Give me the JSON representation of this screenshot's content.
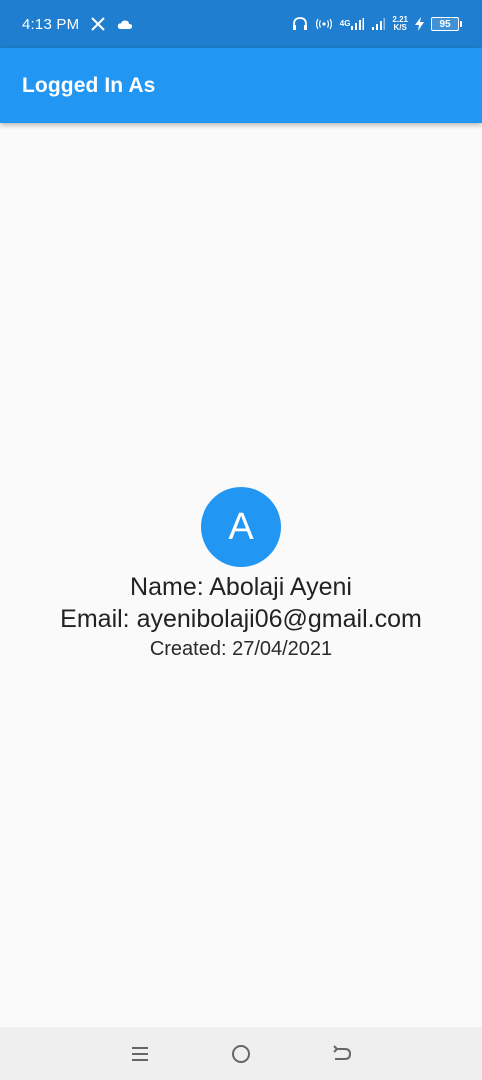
{
  "status_bar": {
    "time": "4:13 PM",
    "network_type": "4G",
    "speed_value": "2.21",
    "speed_unit": "K/S",
    "battery_level": "95"
  },
  "app_bar": {
    "title": "Logged In As"
  },
  "profile": {
    "avatar_letter": "A",
    "name_line": "Name: Abolaji Ayeni",
    "email_line": "Email: ayenibolaji06@gmail.com",
    "created_line": "Created: 27/04/2021"
  },
  "colors": {
    "primary": "#2196f3",
    "status_bar": "#1f7ecf",
    "background": "#fafafa"
  },
  "nav_bar": {
    "icons": [
      "menu-icon",
      "home-circle-icon",
      "back-icon"
    ]
  }
}
